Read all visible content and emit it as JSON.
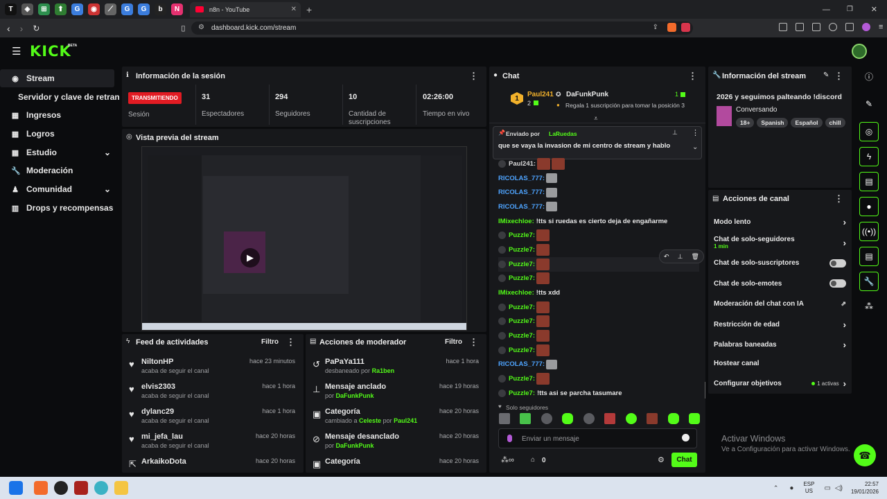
{
  "browser": {
    "tab_title": "n8n - YouTube",
    "url": "dashboard.kick.com/stream",
    "new_tab": "+",
    "tabs": [
      "T",
      "◈",
      "⊞",
      "⬆",
      "G",
      "◉",
      "⟋",
      "G",
      "G",
      "b",
      "N"
    ]
  },
  "header": {
    "logo": "KICK",
    "logo_sup": "BETA"
  },
  "sidebar": {
    "items": [
      {
        "label": "Stream",
        "icon": "stream-icon"
      },
      {
        "label": "Servidor y clave de retransmisión",
        "icon": ""
      },
      {
        "label": "Ingresos",
        "icon": "income-icon"
      },
      {
        "label": "Logros",
        "icon": "trophy-icon"
      },
      {
        "label": "Estudio",
        "icon": "studio-icon",
        "expand": "chevron-down"
      },
      {
        "label": "Moderación",
        "icon": "wrench-icon"
      },
      {
        "label": "Comunidad",
        "icon": "community-icon",
        "expand": "chevron-down"
      },
      {
        "label": "Drops y recompensas",
        "icon": "drops-icon"
      }
    ]
  },
  "session": {
    "title": "Información de la sesión",
    "status_badge": "TRANSMITIENDO",
    "status_label": "Sesión",
    "stats": [
      {
        "value": "31",
        "label": "Espectadores"
      },
      {
        "value": "294",
        "label": "Seguidores"
      },
      {
        "value": "10",
        "label": "Cantidad de suscripciones"
      },
      {
        "value": "02:26:00",
        "label": "Tiempo en vivo"
      }
    ]
  },
  "preview": {
    "title": "Vista previa del stream"
  },
  "activity": {
    "title": "Feed de actividades",
    "filter": "Filtro",
    "items": [
      {
        "name": "NiltonHP",
        "desc": "acaba de seguir el canal",
        "time": "hace 23 minutos"
      },
      {
        "name": "elvis2303",
        "desc": "acaba de seguir el canal",
        "time": "hace 1 hora"
      },
      {
        "name": "dylanc29",
        "desc": "acaba de seguir el canal",
        "time": "hace 1 hora"
      },
      {
        "name": "mi_jefa_lau",
        "desc": "acaba de seguir el canal",
        "time": "hace 20 horas"
      },
      {
        "name": "ArkaikoDota",
        "desc": "",
        "time": "hace 20 horas"
      }
    ]
  },
  "modactions": {
    "title": "Acciones de moderador",
    "filter": "Filtro",
    "items": [
      {
        "name": "PaPaYa111",
        "prefix": "desbaneado por",
        "who": "Ra1ben",
        "time": "hace 1 hora"
      },
      {
        "name": "Mensaje anclado",
        "prefix": "por",
        "who": "DaFunkPunk",
        "time": "hace 19 horas"
      },
      {
        "name": "Categoría",
        "prefix": "cambiado a",
        "who": "Celeste",
        "mid": "por",
        "who2": "Paul241",
        "time": "hace 20 horas"
      },
      {
        "name": "Mensaje desanclado",
        "prefix": "por",
        "who": "DaFunkPunk",
        "time": "hace 20 horas"
      },
      {
        "name": "Categoría",
        "prefix": "",
        "who": "",
        "time": "hace 20 horas"
      }
    ]
  },
  "chat": {
    "title": "Chat",
    "leader": {
      "rank": "1",
      "name": "Paul241",
      "count": "2",
      "gifter": "DaFunkPunk",
      "gifter_count": "1",
      "gift_msg": "Regala 1 suscripción para tomar la posición 3"
    },
    "pinned": {
      "label": "Enviado por",
      "by": "LaRuedas",
      "text": "que se vaya la invasion de mi centro de stream y hablo"
    },
    "messages": [
      {
        "user": "Paul241:",
        "color": "#d8d8d8",
        "text": "",
        "emotes": 2
      },
      {
        "user": "RICOLAS_777:",
        "color": "#4ea4ff",
        "text": "",
        "emotes": 1
      },
      {
        "user": "RICOLAS_777:",
        "color": "#4ea4ff",
        "text": "",
        "emotes": 1
      },
      {
        "user": "RICOLAS_777:",
        "color": "#4ea4ff",
        "text": "",
        "emotes": 1
      },
      {
        "user": "IMixechloe:",
        "color": "#53fc18",
        "text": "!tts si ruedas es cierto deja de engañarme",
        "emotes": 0
      },
      {
        "user": "Puzzle7:",
        "color": "#53fc18",
        "text": "",
        "emotes": 1
      },
      {
        "user": "Puzzle7:",
        "color": "#53fc18",
        "text": "",
        "emotes": 1
      },
      {
        "user": "Puzzle7:",
        "color": "#53fc18",
        "text": "",
        "emotes": 1
      },
      {
        "user": "Puzzle7:",
        "color": "#53fc18",
        "text": "",
        "emotes": 1
      },
      {
        "user": "IMixechloe:",
        "color": "#53fc18",
        "text": "!tts xdd",
        "emotes": 0
      },
      {
        "user": "Puzzle7:",
        "color": "#53fc18",
        "text": "",
        "emotes": 1
      },
      {
        "user": "Puzzle7:",
        "color": "#53fc18",
        "text": "",
        "emotes": 1
      },
      {
        "user": "Puzzle7:",
        "color": "#53fc18",
        "text": "",
        "emotes": 1
      },
      {
        "user": "Puzzle7:",
        "color": "#53fc18",
        "text": "",
        "emotes": 1
      },
      {
        "user": "RICOLAS_777:",
        "color": "#4ea4ff",
        "text": "",
        "emotes": 1
      },
      {
        "user": "Puzzle7:",
        "color": "#53fc18",
        "text": "",
        "emotes": 1
      },
      {
        "user": "Puzzle7:",
        "color": "#53fc18",
        "text": "!tts asi se parcha tasumare",
        "emotes": 0
      }
    ],
    "followers_only": "Solo seguidores",
    "input_placeholder": "Enviar un mensaje",
    "points": "0",
    "send": "Chat"
  },
  "streaminfo": {
    "title": "Información del stream",
    "stream_title": "2026 y seguimos palteando !discord",
    "category": "Conversando",
    "tags": [
      "18+",
      "Spanish",
      "Español",
      "chill"
    ]
  },
  "channel_actions": {
    "title": "Acciones de canal",
    "items": [
      {
        "label": "Modo lento",
        "ctrl": "chevron"
      },
      {
        "label": "Chat de solo-seguidores",
        "sub": "1 min",
        "ctrl": "chevron"
      },
      {
        "label": "Chat de solo-suscriptores",
        "ctrl": "toggle"
      },
      {
        "label": "Chat de solo-emotes",
        "ctrl": "toggle"
      },
      {
        "label": "Moderación del chat con IA",
        "ctrl": "external"
      },
      {
        "label": "Restricción de edad",
        "ctrl": "chevron"
      },
      {
        "label": "Palabras baneadas",
        "ctrl": "chevron"
      },
      {
        "label": "Hostear canal",
        "ctrl": ""
      },
      {
        "label": "Configurar objetivos",
        "extra": "1 activas",
        "ctrl": "chevron"
      }
    ]
  },
  "watermark": {
    "line1": "Activar Windows",
    "line2": "Ve a Configuración para activar Windows."
  },
  "taskbar": {
    "lang1": "ESP",
    "lang2": "US",
    "time": "22:57",
    "date": "19/01/2026"
  },
  "colors": {
    "accent": "#53fc18",
    "live": "#e21b23",
    "bg": "#0b0c0e",
    "panel": "#17181b"
  }
}
